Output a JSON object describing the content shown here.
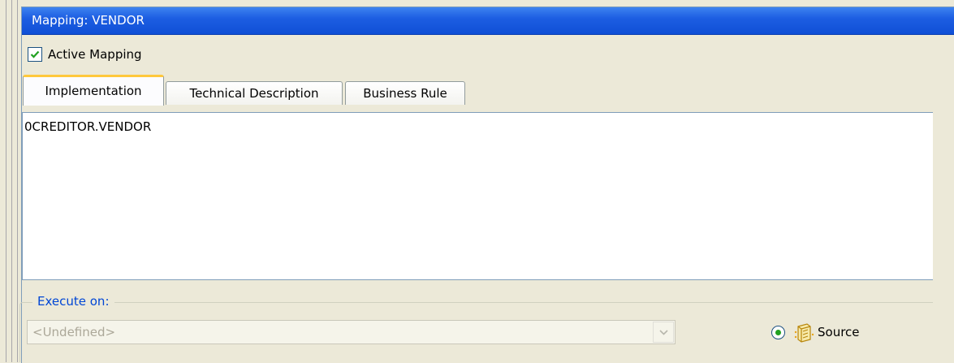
{
  "window": {
    "title": "Mapping: VENDOR"
  },
  "active_mapping": {
    "label": "Active Mapping",
    "checked": true
  },
  "tabs": [
    {
      "label": "Implementation",
      "active": true
    },
    {
      "label": "Technical Description",
      "active": false
    },
    {
      "label": "Business Rule",
      "active": false
    }
  ],
  "editor": {
    "text": "0CREDITOR.VENDOR"
  },
  "execute_on": {
    "legend": "Execute on:",
    "select_value": "<Undefined>",
    "radio_label": "Source",
    "radio_selected": true,
    "icon": "source-table-icon"
  },
  "colors": {
    "titlebar": "#1d5ee2",
    "legend": "#0046d5",
    "active_tab_accent": "#ffc83c"
  }
}
